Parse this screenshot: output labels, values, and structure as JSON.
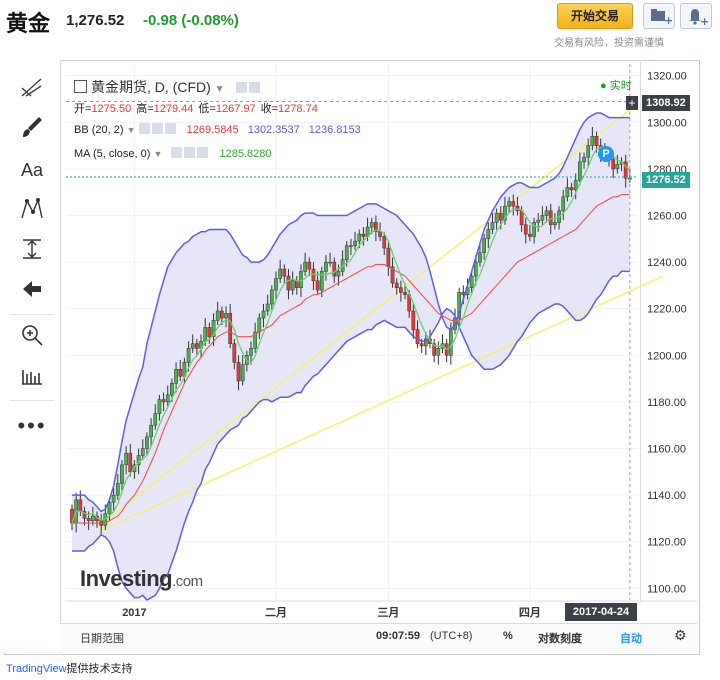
{
  "header": {
    "title": "黄金",
    "price": "1,276.52",
    "change": "-0.98 (-0.08%)",
    "trade_button": "开始交易",
    "risk_note": "交易有风险，投资需谨慎"
  },
  "legend": {
    "symbol": "黄金期货, D, (CFD)",
    "realtime": "实时",
    "ohlc": {
      "o_label": "开=",
      "o": "1275.50",
      "h_label": "高=",
      "h": "1279.44",
      "l_label": "低=",
      "l": "1267.97",
      "c_label": "收=",
      "c": "1278.74"
    },
    "bb": {
      "label": "BB (20, 2)",
      "v1": "1269.5845",
      "v2": "1302.3537",
      "v3": "1236.8153"
    },
    "ma": {
      "label": "MA (5, close, 0)",
      "v": "1285.8280"
    }
  },
  "bottom": {
    "range": "日期范围",
    "time": "09:07:59",
    "tz": "(UTC+8)",
    "pct": "%",
    "log": "对数刻度",
    "auto": "自动"
  },
  "footer": {
    "brand": "TradingView",
    "text": "提供技术支持"
  },
  "logo": {
    "main": "Investing",
    "suffix": ".com"
  },
  "colors": {
    "up": "#26a69a",
    "down": "#ef5350",
    "up_body": "#4caf50",
    "down_body": "#e53935",
    "bb_upper": "#5b5fe0",
    "bb_mid": "#ef5350",
    "ma": "#66d36a",
    "trend": "#f5f05a",
    "band_fill": "#e7e6f8"
  },
  "chart_data": {
    "type": "candlestick",
    "ylim": [
      1095,
      1325
    ],
    "y_ticks": [
      1100,
      1120,
      1140,
      1160,
      1180,
      1200,
      1220,
      1240,
      1260,
      1280,
      1300,
      1320
    ],
    "y_tick_labels": [
      "1100.00",
      "1120.00",
      "1140.00",
      "1160.00",
      "1180.00",
      "1200.00",
      "1220.00",
      "1240.00",
      "1260.00",
      "1280.00",
      "1300.00",
      "1320.00"
    ],
    "x_ticks": [
      {
        "label": "2017",
        "i": 15
      },
      {
        "label": "二月",
        "i": 49
      },
      {
        "label": "三月",
        "i": 76
      },
      {
        "label": "四月",
        "i": 110
      }
    ],
    "x_end_label": "2017-04-24",
    "last_price": "1276.52",
    "crosshair_price": "1308.92",
    "closes": [
      1128,
      1138,
      1133,
      1130,
      1129,
      1131,
      1129,
      1127,
      1132,
      1137,
      1140,
      1145,
      1153,
      1158,
      1150,
      1153,
      1157,
      1160,
      1165,
      1170,
      1175,
      1181,
      1180,
      1183,
      1188,
      1194,
      1191,
      1197,
      1203,
      1205,
      1203,
      1206,
      1212,
      1208,
      1215,
      1219,
      1216,
      1218,
      1205,
      1197,
      1189,
      1196,
      1200,
      1203,
      1210,
      1216,
      1219,
      1222,
      1228,
      1233,
      1237,
      1234,
      1228,
      1232,
      1229,
      1236,
      1240,
      1237,
      1232,
      1228,
      1236,
      1240,
      1240,
      1234,
      1236,
      1241,
      1247,
      1247,
      1249,
      1252,
      1251,
      1255,
      1257,
      1253,
      1251,
      1246,
      1238,
      1231,
      1229,
      1227,
      1226,
      1219,
      1211,
      1205,
      1204,
      1207,
      1205,
      1200,
      1203,
      1205,
      1200,
      1211,
      1216,
      1227,
      1226,
      1229,
      1234,
      1240,
      1244,
      1250,
      1254,
      1257,
      1261,
      1258,
      1264,
      1266,
      1264,
      1262,
      1256,
      1252,
      1251,
      1257,
      1258,
      1260,
      1262,
      1256,
      1257,
      1262,
      1268,
      1272,
      1271,
      1275,
      1283,
      1285,
      1290,
      1294,
      1290,
      1287,
      1286,
      1284,
      1280,
      1282,
      1283,
      1276,
      1276
    ],
    "bb_upper": [
      1140,
      1140,
      1140,
      1140,
      1138,
      1137,
      1135,
      1133,
      1134,
      1138,
      1144,
      1153,
      1163,
      1172,
      1178,
      1184,
      1190,
      1195,
      1205,
      1212,
      1219,
      1226,
      1232,
      1238,
      1241,
      1244,
      1246,
      1248,
      1249,
      1251,
      1252,
      1253,
      1253,
      1254,
      1254,
      1254,
      1254,
      1254,
      1252,
      1249,
      1246,
      1243,
      1242,
      1240,
      1240,
      1240,
      1241,
      1243,
      1246,
      1249,
      1252,
      1254,
      1256,
      1257,
      1258,
      1260,
      1261,
      1261,
      1261,
      1260,
      1260,
      1260,
      1260,
      1260,
      1260,
      1260,
      1260,
      1261,
      1262,
      1263,
      1264,
      1265,
      1265,
      1265,
      1264,
      1263,
      1262,
      1261,
      1260,
      1258,
      1256,
      1254,
      1252,
      1249,
      1246,
      1242,
      1236,
      1229,
      1222,
      1216,
      1212,
      1211,
      1213,
      1218,
      1224,
      1230,
      1236,
      1242,
      1248,
      1254,
      1258,
      1262,
      1265,
      1268,
      1270,
      1272,
      1273,
      1274,
      1274,
      1273,
      1272,
      1272,
      1272,
      1273,
      1274,
      1275,
      1276,
      1278,
      1281,
      1285,
      1289,
      1293,
      1297,
      1300,
      1302,
      1303,
      1304,
      1304,
      1303,
      1302,
      1302,
      1302,
      1302,
      1302,
      1302
    ],
    "bb_mid": [
      1128,
      1128,
      1128,
      1128,
      1128,
      1128,
      1128,
      1128,
      1128,
      1129,
      1130,
      1131,
      1133,
      1136,
      1138,
      1140,
      1143,
      1146,
      1150,
      1154,
      1158,
      1163,
      1168,
      1172,
      1176,
      1180,
      1184,
      1188,
      1191,
      1194,
      1197,
      1199,
      1202,
      1204,
      1206,
      1208,
      1209,
      1210,
      1210,
      1209,
      1208,
      1208,
      1208,
      1208,
      1209,
      1210,
      1211,
      1212,
      1213,
      1215,
      1217,
      1218,
      1219,
      1220,
      1221,
      1222,
      1224,
      1225,
      1226,
      1226,
      1227,
      1228,
      1229,
      1230,
      1231,
      1232,
      1233,
      1234,
      1235,
      1236,
      1237,
      1238,
      1238,
      1239,
      1239,
      1239,
      1238,
      1237,
      1236,
      1235,
      1234,
      1232,
      1230,
      1228,
      1226,
      1224,
      1222,
      1220,
      1218,
      1217,
      1216,
      1215,
      1215,
      1215,
      1216,
      1217,
      1218,
      1220,
      1222,
      1224,
      1226,
      1228,
      1230,
      1232,
      1234,
      1236,
      1238,
      1240,
      1241,
      1242,
      1243,
      1244,
      1245,
      1246,
      1247,
      1248,
      1249,
      1250,
      1251,
      1252,
      1253,
      1254,
      1256,
      1258,
      1260,
      1262,
      1264,
      1265,
      1266,
      1267,
      1268,
      1268,
      1269,
      1269,
      1269
    ],
    "bb_lower": [
      1116,
      1116,
      1116,
      1116,
      1118,
      1119,
      1121,
      1123,
      1122,
      1120,
      1116,
      1109,
      1103,
      1100,
      1098,
      1096,
      1096,
      1097,
      1095,
      1096,
      1097,
      1100,
      1104,
      1106,
      1111,
      1116,
      1122,
      1128,
      1133,
      1137,
      1142,
      1145,
      1151,
      1154,
      1158,
      1162,
      1164,
      1166,
      1168,
      1169,
      1170,
      1173,
      1174,
      1176,
      1178,
      1180,
      1181,
      1181,
      1180,
      1181,
      1182,
      1182,
      1182,
      1183,
      1184,
      1184,
      1187,
      1189,
      1191,
      1192,
      1194,
      1196,
      1198,
      1200,
      1202,
      1204,
      1206,
      1207,
      1208,
      1209,
      1210,
      1211,
      1211,
      1213,
      1214,
      1215,
      1214,
      1213,
      1212,
      1212,
      1212,
      1210,
      1208,
      1207,
      1206,
      1206,
      1208,
      1211,
      1214,
      1218,
      1220,
      1219,
      1217,
      1212,
      1208,
      1204,
      1200,
      1198,
      1196,
      1194,
      1194,
      1194,
      1195,
      1196,
      1198,
      1200,
      1203,
      1206,
      1208,
      1211,
      1214,
      1216,
      1218,
      1219,
      1220,
      1221,
      1222,
      1222,
      1221,
      1219,
      1217,
      1215,
      1215,
      1216,
      1218,
      1221,
      1224,
      1226,
      1229,
      1232,
      1234,
      1234,
      1236,
      1236,
      1236
    ],
    "trend_upper": [
      {
        "i": 6,
        "y": 1126
      },
      {
        "i": 136,
        "y": 1308
      }
    ],
    "trend_lower": [
      {
        "i": 6,
        "y": 1124
      },
      {
        "i": 142,
        "y": 1234
      }
    ]
  }
}
